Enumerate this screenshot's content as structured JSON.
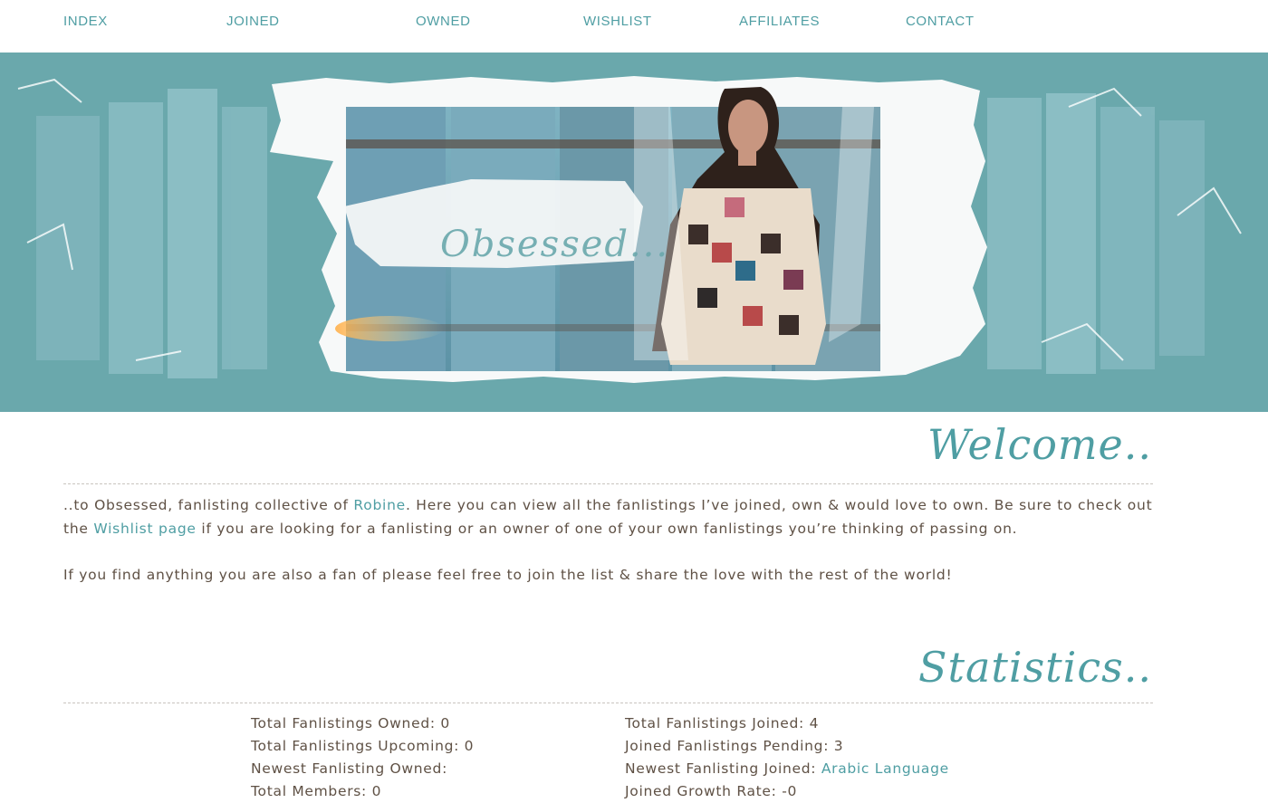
{
  "nav": {
    "items": [
      "INDEX",
      "JOINED",
      "OWNED",
      "WISHLIST",
      "AFFILIATES",
      "CONTACT"
    ]
  },
  "header": {
    "banner_text": "Obsessed..."
  },
  "welcome": {
    "title": "Welcome..",
    "p1_a": "..to Obsessed, fanlisting collective of ",
    "p1_link": "Robine",
    "p1_b": ". Here you can view all the fanlistings I’ve joined, own & would love to own. Be sure to check out the ",
    "p1_link2": "Wishlist page",
    "p1_c": " if you are looking for a fanlisting or an owner of one of your own fanlistings you’re thinking of passing on.",
    "p2": "If you find anything you are also a fan of please feel free to join the list & share the love with the rest of the world!"
  },
  "statistics": {
    "title": "Statistics..",
    "left": [
      "Total Fanlistings Owned: 0",
      "Total Fanlistings Upcoming: 0",
      "Newest Fanlisting Owned:",
      "Total Members: 0"
    ],
    "right": {
      "joined": "Total Fanlistings Joined: 4",
      "pending": "Joined Fanlistings Pending: 3",
      "newest_label": "Newest Fanlisting Joined: ",
      "newest_link": "Arabic Language",
      "growth": "Joined Growth Rate: -0"
    }
  },
  "colors": {
    "accent": "#4f9ea3",
    "header_bg": "#6aa8ac",
    "text": "#5f5145"
  }
}
